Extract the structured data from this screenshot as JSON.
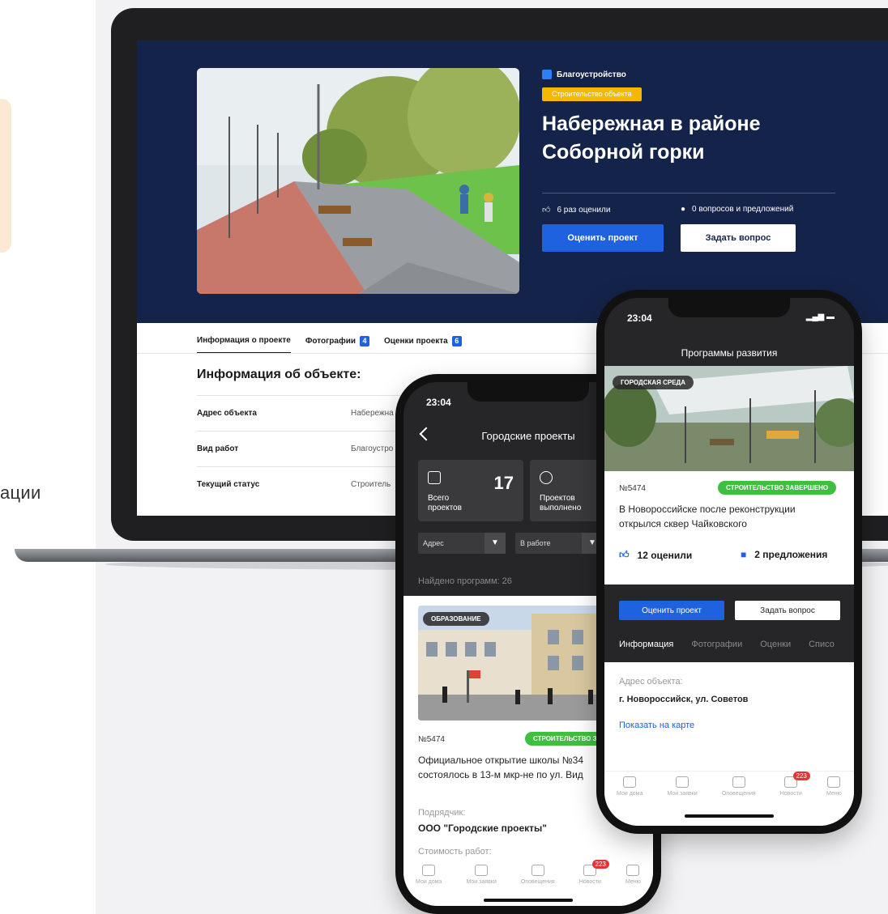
{
  "side": {
    "text": "ации"
  },
  "laptop": {
    "category": "Благоустройство",
    "status_badge": "Строительство объекта",
    "title": "Набережная в районе Соборной горки",
    "ratings_text": "6 раз оценили",
    "questions_text": "0 вопросов и предложений",
    "rate_button": "Оценить проект",
    "ask_button": "Задать вопрос",
    "tabs": [
      {
        "label": "Информация о проекте",
        "count": ""
      },
      {
        "label": "Фотографии",
        "count": "4"
      },
      {
        "label": "Оценки проекта",
        "count": "6"
      }
    ],
    "info_title": "Информация об объекте:",
    "rows": [
      {
        "key": "Адрес объекта",
        "value": "Набережна"
      },
      {
        "key": "Вид работ",
        "value": "Благоустро"
      },
      {
        "key": "Текущий статус",
        "value": "Строитель"
      }
    ]
  },
  "phone1": {
    "time": "23:04",
    "header": "Городские проекты",
    "total_label": "Всего проектов",
    "total_value": "17",
    "done_label": "Проектов выполнено",
    "filter_address": "Адрес",
    "filter_status": "В работе",
    "found": "Найдено программ: 26",
    "card": {
      "category": "ОБРАЗОВАНИЕ",
      "status": "СТРОИТЕЛЬСТВО З",
      "number": "№5474",
      "title_line1": "Официальное открытие школы №34",
      "title_line2": "состоялось в 13-м мкр-не по ул. Вид",
      "contractor_label": "Подрядчик:",
      "contractor_value": "ООО \"Городские проекты\"",
      "cost_label": "Стоимость работ:"
    },
    "tabbar": [
      "Мои дома",
      "Мои заявки",
      "Оповещения",
      "Новости",
      "Меню"
    ],
    "news_badge": "223"
  },
  "phone2": {
    "time": "23:04",
    "header": "Программы развития",
    "category": "ГОРОДСКАЯ СРЕДА",
    "status": "СТРОИТЕЛЬСТВО ЗАВЕРШЕНО",
    "number": "№5474",
    "title_line1": "В Новороссийске после реконструкции",
    "title_line2": "открылся сквер Чайковского",
    "rated": "12 оценили",
    "proposals": "2 предложения",
    "rate_button": "Оценить проект",
    "ask_button": "Задать вопрос",
    "tabs": [
      "Информация",
      "Фотографии",
      "Оценки",
      "Списо"
    ],
    "address_label": "Адрес объекта:",
    "address_value": "г. Новороссийск, ул. Советов",
    "map_link": "Показать на карте",
    "tabbar": [
      "Мои дома",
      "Мои заявки",
      "Оповещения",
      "Новости",
      "Меню"
    ],
    "news_badge": "223"
  }
}
